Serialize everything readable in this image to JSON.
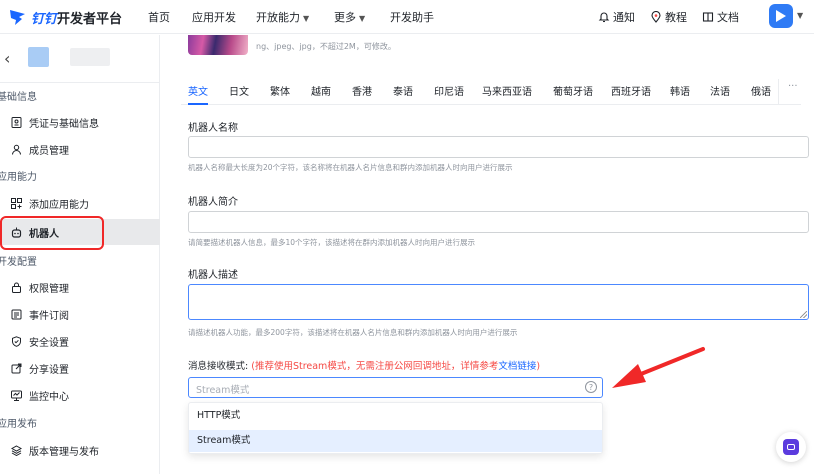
{
  "topnav": {
    "brand": "钉钉",
    "title": "开发者平台",
    "items": [
      {
        "label": "首页"
      },
      {
        "label": "应用开发"
      },
      {
        "label": "开放能力"
      },
      {
        "label": "更多"
      },
      {
        "label": "开发助手"
      }
    ],
    "right": {
      "notice": "通知",
      "tutorial": "教程",
      "docs": "文档"
    }
  },
  "sidebar": {
    "sections": [
      {
        "title": "基础信息",
        "items": [
          {
            "label": "凭证与基础信息",
            "icon": "credential-icon"
          },
          {
            "label": "成员管理",
            "icon": "member-icon"
          }
        ]
      },
      {
        "title": "应用能力",
        "items": [
          {
            "label": "添加应用能力",
            "icon": "apps-grid-icon"
          },
          {
            "label": "机器人",
            "icon": "robot-icon",
            "active": true
          }
        ]
      },
      {
        "title": "开发配置",
        "items": [
          {
            "label": "权限管理",
            "icon": "lock-icon"
          },
          {
            "label": "事件订阅",
            "icon": "event-icon"
          },
          {
            "label": "安全设置",
            "icon": "shield-icon"
          },
          {
            "label": "分享设置",
            "icon": "share-icon"
          },
          {
            "label": "监控中心",
            "icon": "monitor-icon"
          }
        ]
      },
      {
        "title": "应用发布",
        "items": [
          {
            "label": "版本管理与发布",
            "icon": "layers-icon"
          }
        ]
      }
    ]
  },
  "main": {
    "image_hint": "ng、jpeg、jpg，不超过2M，可修改。",
    "tabs": [
      "英文",
      "日文",
      "繁体",
      "越南",
      "香港",
      "泰语",
      "印尼语",
      "马来西亚语",
      "葡萄牙语",
      "西班牙语",
      "韩语",
      "法语",
      "俄语"
    ],
    "tab_more": "···",
    "fields": {
      "name": {
        "label": "机器人名称",
        "help": "机器人名称最大长度为20个字符，该名称将在机器人名片信息和群内添加机器人时向用户进行展示"
      },
      "intro": {
        "label": "机器人简介",
        "help": "请简要描述机器人信息，最多10个字符，该描述将在群内添加机器人时向用户进行展示"
      },
      "desc": {
        "label": "机器人描述",
        "help": "请描述机器人功能，最多200字符，该描述将在机器人名片信息和群内添加机器人时向用户进行展示"
      }
    },
    "mode": {
      "label": "消息接收模式:",
      "note": "(推荐使用Stream模式，无需注册公网回调地址，详情参考",
      "link": "文档链接",
      "close": ")",
      "placeholder": "Stream模式",
      "help_glyph": "?",
      "options": [
        "HTTP模式",
        "Stream模式"
      ],
      "selected": "Stream模式"
    }
  },
  "colors": {
    "accent": "#1a66ff",
    "annotation_red": "#f02828",
    "note_red": "#f54a45"
  }
}
